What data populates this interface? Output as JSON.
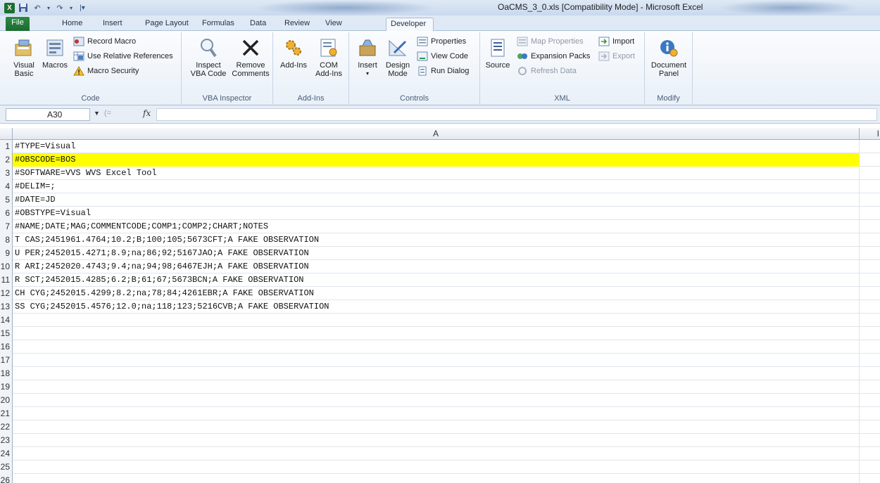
{
  "window": {
    "title": "OaCMS_3_0.xls  [Compatibility Mode]  -  Microsoft Excel",
    "app_icon": "X"
  },
  "quick_access": {
    "icons": [
      "excel-app-icon",
      "save-icon",
      "undo-icon",
      "redo-icon",
      "customize-icon"
    ]
  },
  "tabs": [
    {
      "label": "File"
    },
    {
      "label": "Home"
    },
    {
      "label": "Insert"
    },
    {
      "label": "Page Layout"
    },
    {
      "label": "Formulas"
    },
    {
      "label": "Data"
    },
    {
      "label": "Review"
    },
    {
      "label": "View"
    },
    {
      "label": "Developer",
      "active": true
    }
  ],
  "ribbon": {
    "code": {
      "label": "Code",
      "visual_basic": "Visual Basic",
      "visual_basic_l1": "Visual",
      "visual_basic_l2": "Basic",
      "macros": "Macros",
      "record_macro": "Record Macro",
      "use_relative": "Use Relative References",
      "macro_security": "Macro Security"
    },
    "vba_inspector": {
      "label": "VBA Inspector",
      "inspect_l1": "Inspect",
      "inspect_l2": "VBA Code",
      "remove_l1": "Remove",
      "remove_l2": "Comments"
    },
    "addins": {
      "label": "Add-Ins",
      "addins": "Add-Ins",
      "com_l1": "COM",
      "com_l2": "Add-Ins"
    },
    "controls": {
      "label": "Controls",
      "insert": "Insert",
      "design_l1": "Design",
      "design_l2": "Mode",
      "properties": "Properties",
      "view_code": "View Code",
      "run_dialog": "Run Dialog"
    },
    "xml": {
      "label": "XML",
      "source": "Source",
      "map_properties": "Map Properties",
      "expansion_packs": "Expansion Packs",
      "refresh_data": "Refresh Data",
      "import": "Import",
      "export": "Export"
    },
    "modify": {
      "label": "Modify",
      "doc_panel_l1": "Document",
      "doc_panel_l2": "Panel"
    }
  },
  "formula_bar": {
    "name_box": "A30",
    "fx": "fx",
    "value": ""
  },
  "grid": {
    "columns": [
      "A"
    ],
    "next_column_partial": "I",
    "highlight_row": 2,
    "rows": [
      {
        "num": "1",
        "a": "#TYPE=Visual"
      },
      {
        "num": "2",
        "a": "#OBSCODE=BOS"
      },
      {
        "num": "3",
        "a": "#SOFTWARE=VVS WVS Excel Tool"
      },
      {
        "num": "4",
        "a": "#DELIM=;"
      },
      {
        "num": "5",
        "a": "#DATE=JD"
      },
      {
        "num": "6",
        "a": "#OBSTYPE=Visual"
      },
      {
        "num": "7",
        "a": "#NAME;DATE;MAG;COMMENTCODE;COMP1;COMP2;CHART;NOTES"
      },
      {
        "num": "8",
        "a": "T CAS;2451961.4764;10.2;B;100;105;5673CFT;A FAKE OBSERVATION"
      },
      {
        "num": "9",
        "a": "U PER;2452015.4271;8.9;na;86;92;5167JAO;A FAKE OBSERVATION"
      },
      {
        "num": "10",
        "a": "R ARI;2452020.4743;9.4;na;94;98;6467EJH;A FAKE OBSERVATION"
      },
      {
        "num": "11",
        "a": "R SCT;2452015.4285;6.2;B;61;67;5673BCN;A FAKE OBSERVATION"
      },
      {
        "num": "12",
        "a": "CH CYG;2452015.4299;8.2;na;78;84;4261EBR;A FAKE OBSERVATION"
      },
      {
        "num": "13",
        "a": "SS CYG;2452015.4576;12.0;na;118;123;5216CVB;A FAKE OBSERVATION"
      },
      {
        "num": "14",
        "a": ""
      },
      {
        "num": "15",
        "a": ""
      },
      {
        "num": "16",
        "a": ""
      },
      {
        "num": "17",
        "a": ""
      },
      {
        "num": "18",
        "a": ""
      },
      {
        "num": "19",
        "a": ""
      },
      {
        "num": "20",
        "a": ""
      },
      {
        "num": "21",
        "a": ""
      },
      {
        "num": "22",
        "a": ""
      },
      {
        "num": "23",
        "a": ""
      },
      {
        "num": "24",
        "a": ""
      },
      {
        "num": "25",
        "a": ""
      },
      {
        "num": "26",
        "a": ""
      }
    ]
  },
  "colors": {
    "highlight": "#ffff00",
    "file_tab": "#1c6b31"
  }
}
